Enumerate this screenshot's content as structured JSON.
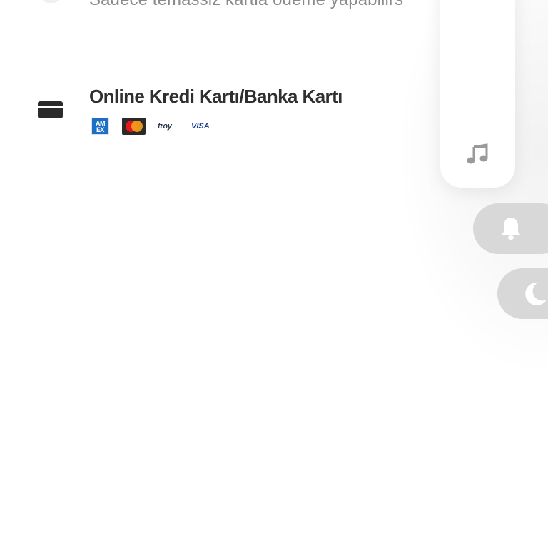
{
  "top_option": {
    "description": "Sadece temassiz kartla ödeme yapabilirs"
  },
  "card_option": {
    "title": "Online Kredi Kartı/Banka Kartı",
    "icon": "credit-card-icon",
    "brands": {
      "amex": "AM EX",
      "mastercard": "mastercard-logo",
      "troy": "troy",
      "visa": "VISA"
    }
  },
  "system_panel": {
    "media_icon": "music-note-icon",
    "bell_icon": "bell-icon",
    "moon_icon": "moon-icon"
  },
  "colors": {
    "title_text": "#2f2f2f",
    "secondary_text": "#8a8a8a",
    "pill_bg": "#d8d8d8",
    "icon_on_pill": "#ffffff",
    "music_icon": "#9a9a9a"
  }
}
